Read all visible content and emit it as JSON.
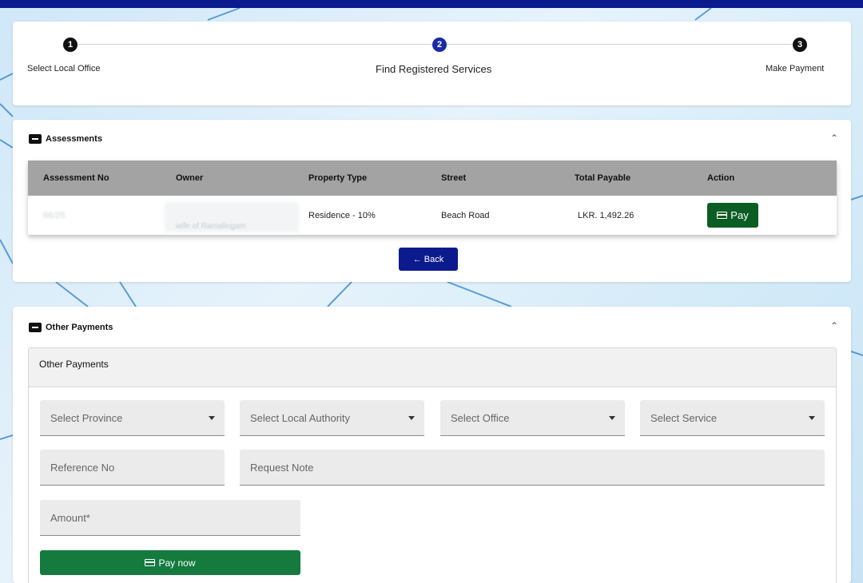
{
  "stepper": {
    "steps": [
      {
        "number": "1",
        "label": "Select Local Office"
      },
      {
        "number": "2",
        "label": "Find Registered Services"
      },
      {
        "number": "3",
        "label": "Make Payment"
      }
    ],
    "active_step": 2
  },
  "assessments": {
    "title": "Assessments",
    "columns": [
      "Assessment No",
      "Owner",
      "Property Type",
      "Street",
      "Total Payable",
      "Action"
    ],
    "rows": [
      {
        "assessment_no": "66/25",
        "owner_sub": "wife of Ramalingam",
        "property_type": "Residence - 10%",
        "street": "Beach Road",
        "total_payable": "LKR. 1,492.26",
        "action": "Pay"
      }
    ],
    "back_label": "← Back"
  },
  "other_payments": {
    "title": "Other Payments",
    "panel_title": "Other Payments",
    "fields": {
      "province": "Select Province",
      "local_authority": "Select Local Authority",
      "office": "Select Office",
      "service": "Select Service",
      "reference": "Reference No",
      "note": "Request Note",
      "amount": "Amount*"
    },
    "pay_now_label": "Pay now"
  },
  "colors": {
    "primary": "#0b1a8c",
    "pay": "#0c5d23",
    "pay_now": "#147a3d"
  }
}
